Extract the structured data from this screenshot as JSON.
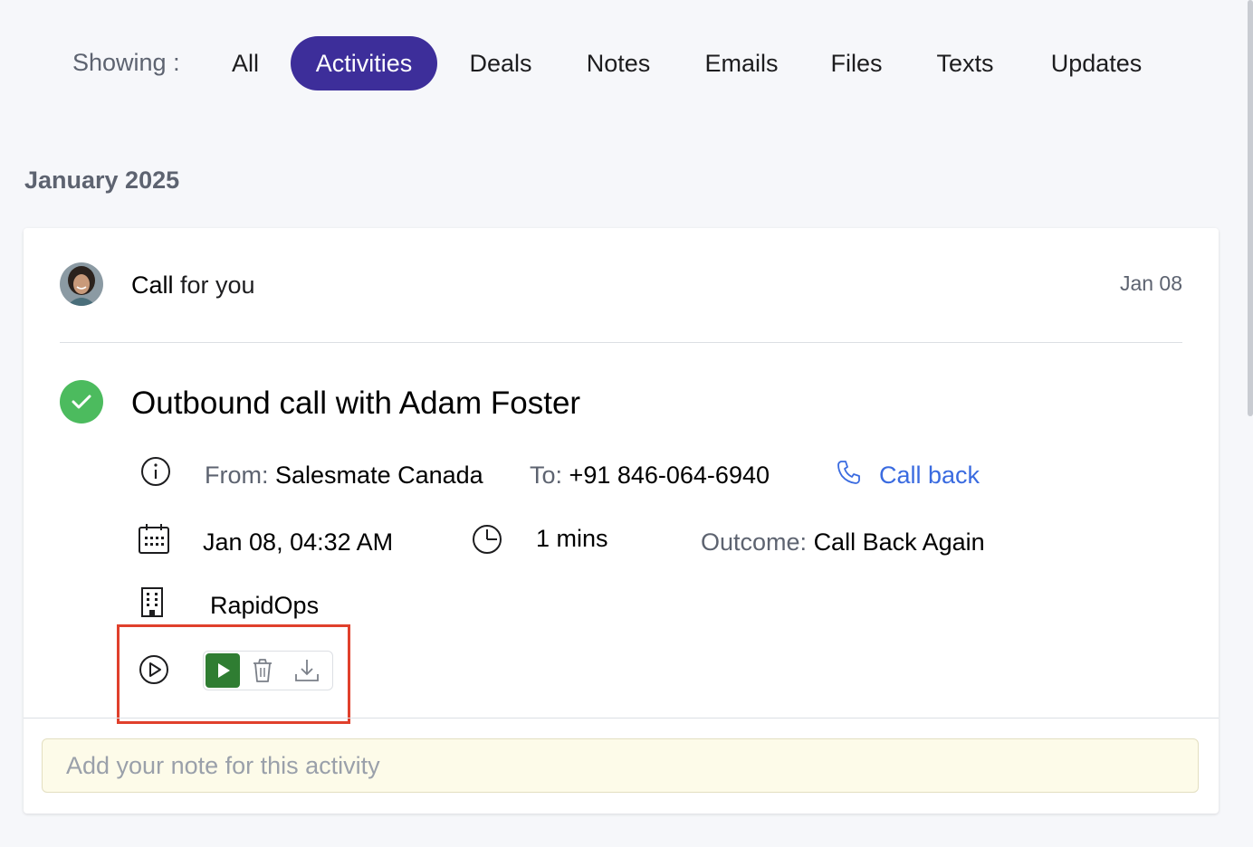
{
  "filters": {
    "showing_label": "Showing :",
    "tabs": [
      {
        "label": "All"
      },
      {
        "label": "Activities",
        "active": true
      },
      {
        "label": "Deals"
      },
      {
        "label": "Notes"
      },
      {
        "label": "Emails"
      },
      {
        "label": "Files"
      },
      {
        "label": "Texts"
      },
      {
        "label": "Updates"
      }
    ]
  },
  "timeline": {
    "month": "January 2025",
    "card": {
      "title_bold": "Call",
      "title_rest": " for you",
      "date": "Jan 08",
      "activity_title": "Outbound call with Adam Foster",
      "from_label": "From:",
      "from_value": "Salesmate Canada",
      "to_label": "To:",
      "to_value": "+91 846-064-6940",
      "call_back": "Call back",
      "datetime": "Jan 08, 04:32 AM",
      "duration": "1 mins",
      "outcome_label": "Outcome:",
      "outcome_value": "Call Back Again",
      "company": "RapidOps",
      "note_placeholder": "Add your note for this activity"
    }
  },
  "icons": [
    "avatar",
    "check-icon",
    "info-icon",
    "phone-icon",
    "calendar-icon",
    "clock-icon",
    "building-icon",
    "play-circle-icon",
    "play-icon",
    "trash-icon",
    "download-icon"
  ],
  "colors": {
    "active_tab": "#3d2e9a",
    "check": "#4cbb5e",
    "link": "#3a6be0",
    "play_button": "#2f7d32",
    "highlight": "#e0402c",
    "note_bg": "#fdfbe9"
  }
}
